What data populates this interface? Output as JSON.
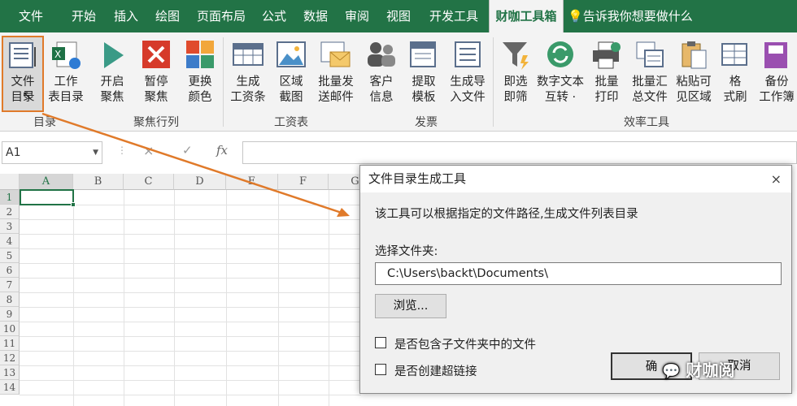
{
  "tabs": [
    "文件",
    "开始",
    "插入",
    "绘图",
    "页面布局",
    "公式",
    "数据",
    "审阅",
    "视图",
    "开发工具",
    "财咖工具箱"
  ],
  "tell_me": "告诉我你想要做什么",
  "ribbon": {
    "buttons": [
      {
        "l1": "文件",
        "l2": "目录",
        "icon": "folder-list-icon"
      },
      {
        "l1": "工作",
        "l2": "表目录",
        "icon": "excel-sheet-icon"
      },
      {
        "l1": "开启",
        "l2": "聚焦",
        "icon": "play-icon"
      },
      {
        "l1": "暂停",
        "l2": "聚焦",
        "icon": "stop-icon"
      },
      {
        "l1": "更换",
        "l2": "颜色",
        "icon": "color-blocks-icon"
      },
      {
        "l1": "生成",
        "l2": "工资条",
        "icon": "table-icon"
      },
      {
        "l1": "区域",
        "l2": "截图",
        "icon": "image-icon"
      },
      {
        "l1": "批量发",
        "l2": "送邮件",
        "icon": "mail-icon"
      },
      {
        "l1": "客户",
        "l2": "信息",
        "icon": "people-icon"
      },
      {
        "l1": "提取",
        "l2": "模板",
        "icon": "template-icon"
      },
      {
        "l1": "生成导",
        "l2": "入文件",
        "icon": "import-file-icon"
      },
      {
        "l1": "即选",
        "l2": "即筛",
        "icon": "filter-icon"
      },
      {
        "l1": "数字文本",
        "l2": "互转 ·",
        "icon": "convert-icon"
      },
      {
        "l1": "批量",
        "l2": "打印",
        "icon": "printer-icon"
      },
      {
        "l1": "批量汇",
        "l2": "总文件",
        "icon": "summary-icon"
      },
      {
        "l1": "粘贴可",
        "l2": "见区域",
        "icon": "paste-icon"
      },
      {
        "l1": "格",
        "l2": "式刷",
        "icon": "format-brush-icon"
      },
      {
        "l1": "备份",
        "l2": "工作簿",
        "icon": "backup-icon"
      }
    ],
    "groups": [
      "目录",
      "聚焦行列",
      "工资表",
      "发票",
      "效率工具"
    ]
  },
  "formula_bar": {
    "name_box": "A1",
    "cancel": "×",
    "enter": "✓",
    "fx": "fx"
  },
  "columns": [
    "A",
    "B",
    "C",
    "D",
    "E",
    "F",
    "G"
  ],
  "rows": [
    "1",
    "2",
    "3",
    "4",
    "5",
    "6",
    "7",
    "8",
    "9",
    "10",
    "11",
    "12",
    "13",
    "14"
  ],
  "dialog": {
    "title": "文件目录生成工具",
    "close": "×",
    "description": "该工具可以根据指定的文件路径,生成文件列表目录",
    "folder_label": "选择文件夹:",
    "path_value": "C:\\Users\\backt\\Documents\\",
    "browse": "浏览...",
    "include_subfolders": "是否包含子文件夹中的文件",
    "create_hyperlink": "是否创建超链接",
    "ok": "确",
    "cancel": "取消"
  },
  "watermark": "财咖阅"
}
